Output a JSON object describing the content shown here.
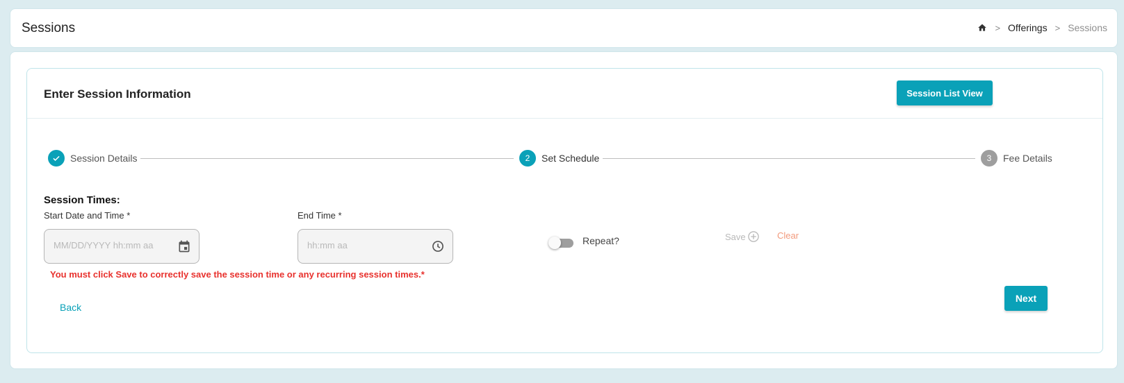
{
  "header": {
    "title": "Sessions",
    "breadcrumb": {
      "home_icon": "home-icon",
      "separator": ">",
      "items": [
        "Offerings",
        "Sessions"
      ]
    }
  },
  "card": {
    "title": "Enter Session Information",
    "list_view_button": "Session List View"
  },
  "stepper": {
    "steps": [
      {
        "number": "1",
        "label": "Session Details",
        "state": "complete",
        "icon": "check-icon"
      },
      {
        "number": "2",
        "label": "Set Schedule",
        "state": "active"
      },
      {
        "number": "3",
        "label": "Fee Details",
        "state": "pending"
      }
    ]
  },
  "session_times": {
    "section_title": "Session Times:",
    "start": {
      "label": "Start Date and Time *",
      "value": "",
      "placeholder": "MM/DD/YYYY hh:mm aa",
      "icon": "calendar-icon"
    },
    "end": {
      "label": "End Time *",
      "value": "",
      "placeholder": "hh:mm aa",
      "icon": "clock-icon"
    },
    "repeat_label": "Repeat?",
    "repeat_on": false,
    "save_label": "Save",
    "save_icon": "plus-circle-icon",
    "clear_label": "Clear",
    "warning": "You must click Save to correctly save the session time or any recurring session times.*"
  },
  "nav": {
    "back_label": "Back",
    "next_label": "Next"
  },
  "colors": {
    "accent": "#0aa1b8",
    "warning": "#e8312d",
    "clear": "#f29a7c",
    "background": "#dcecf0"
  }
}
